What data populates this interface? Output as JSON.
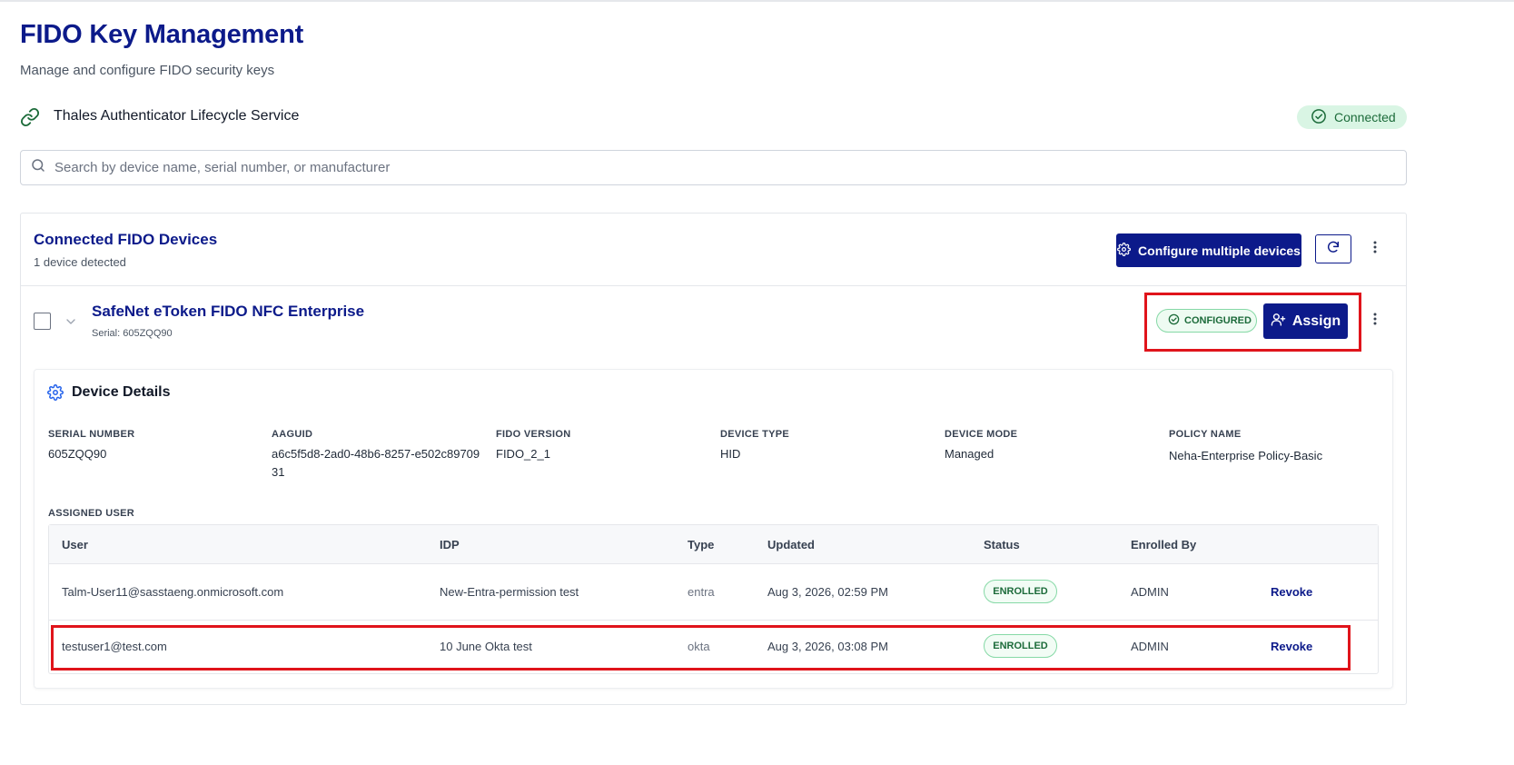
{
  "header": {
    "title": "FIDO Key Management",
    "subtitle": "Manage and configure FIDO security keys"
  },
  "service": {
    "name": "Thales Authenticator Lifecycle Service",
    "status": "Connected",
    "icon": "link-icon"
  },
  "search": {
    "placeholder": "Search by device name, serial number, or manufacturer",
    "value": ""
  },
  "devices_panel": {
    "title": "Connected FIDO Devices",
    "count_text": "1 device detected",
    "configure_button": "Configure multiple devices"
  },
  "device": {
    "name": "SafeNet eToken FIDO NFC Enterprise",
    "serial_text": "Serial: 605ZQQ90",
    "status_badge": "CONFIGURED",
    "assign_button": "Assign"
  },
  "details": {
    "title": "Device Details",
    "fields": [
      {
        "label": "SERIAL NUMBER",
        "value": "605ZQQ90"
      },
      {
        "label": "AAGUID",
        "value": "a6c5f5d8-2ad0-48b6-8257-e502c8970931"
      },
      {
        "label": "FIDO VERSION",
        "value": "FIDO_2_1"
      },
      {
        "label": "DEVICE TYPE",
        "value": "HID"
      },
      {
        "label": "DEVICE MODE",
        "value": "Managed"
      },
      {
        "label": "POLICY NAME",
        "value": "Neha-Enterprise Policy-Basic"
      }
    ],
    "assigned_user_label": "ASSIGNED USER"
  },
  "users_table": {
    "columns": [
      "User",
      "IDP",
      "Type",
      "Updated",
      "Status",
      "Enrolled By"
    ],
    "rows": [
      {
        "user": "Talm-User11@sasstaeng.onmicrosoft.com",
        "idp": "New-Entra-permission test",
        "type": "entra",
        "updated": "Aug 3, 2026, 02:59 PM",
        "status": "ENROLLED",
        "enrolled_by": "ADMIN",
        "action": "Revoke"
      },
      {
        "user": "testuser1@test.com",
        "idp": "10 June Okta test",
        "type": "okta",
        "updated": "Aug 3, 2026, 03:08 PM",
        "status": "ENROLLED",
        "enrolled_by": "ADMIN",
        "action": "Revoke"
      }
    ]
  },
  "colors": {
    "primary": "#0c1a8a",
    "success_bg": "#d9f5e4",
    "success_text": "#1c6b3a",
    "highlight": "#e0141b"
  }
}
